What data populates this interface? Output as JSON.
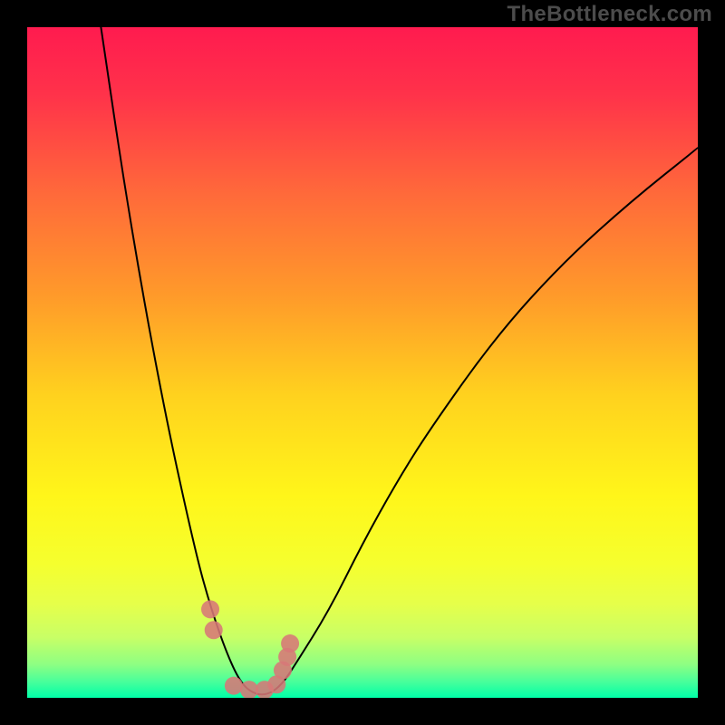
{
  "watermark": "TheBottleneck.com",
  "chart_data": {
    "type": "line",
    "title": "",
    "xlabel": "",
    "ylabel": "",
    "xlim": [
      0,
      100
    ],
    "ylim": [
      0,
      100
    ],
    "grid": false,
    "legend": false,
    "note": "Values are normalized percentages estimated from pixel positions; minimum of the curve (≈0) occurs near x≈33.",
    "series": [
      {
        "name": "bottleneck-curve",
        "x": [
          11,
          15,
          20,
          25,
          27.5,
          30,
          32,
          34,
          36,
          38,
          40,
          45,
          50,
          55,
          60,
          70,
          80,
          90,
          100
        ],
        "values": [
          100,
          73,
          45,
          22,
          13,
          6,
          2,
          0.5,
          0.5,
          2,
          5,
          13,
          23,
          32,
          40,
          54,
          65,
          74,
          82
        ]
      }
    ],
    "markers": {
      "name": "highlighted-points",
      "x": [
        27.3,
        27.8,
        30.8,
        33.1,
        35.4,
        37.2,
        38.1,
        38.8,
        39.2
      ],
      "values": [
        13.2,
        10.1,
        1.8,
        1.2,
        1.2,
        2.0,
        4.1,
        6.1,
        8.1
      ],
      "radius": 10
    },
    "background_gradient": {
      "type": "vertical",
      "stops": [
        {
          "offset": 0.0,
          "color": "#ff1b4f"
        },
        {
          "offset": 0.1,
          "color": "#ff324a"
        },
        {
          "offset": 0.25,
          "color": "#ff6a3a"
        },
        {
          "offset": 0.4,
          "color": "#ff9a2a"
        },
        {
          "offset": 0.55,
          "color": "#ffd21e"
        },
        {
          "offset": 0.7,
          "color": "#fff61a"
        },
        {
          "offset": 0.8,
          "color": "#f5ff2e"
        },
        {
          "offset": 0.86,
          "color": "#e6ff4a"
        },
        {
          "offset": 0.91,
          "color": "#c8ff66"
        },
        {
          "offset": 0.95,
          "color": "#8eff82"
        },
        {
          "offset": 0.975,
          "color": "#4bff9a"
        },
        {
          "offset": 1.0,
          "color": "#00ffa8"
        }
      ]
    }
  }
}
